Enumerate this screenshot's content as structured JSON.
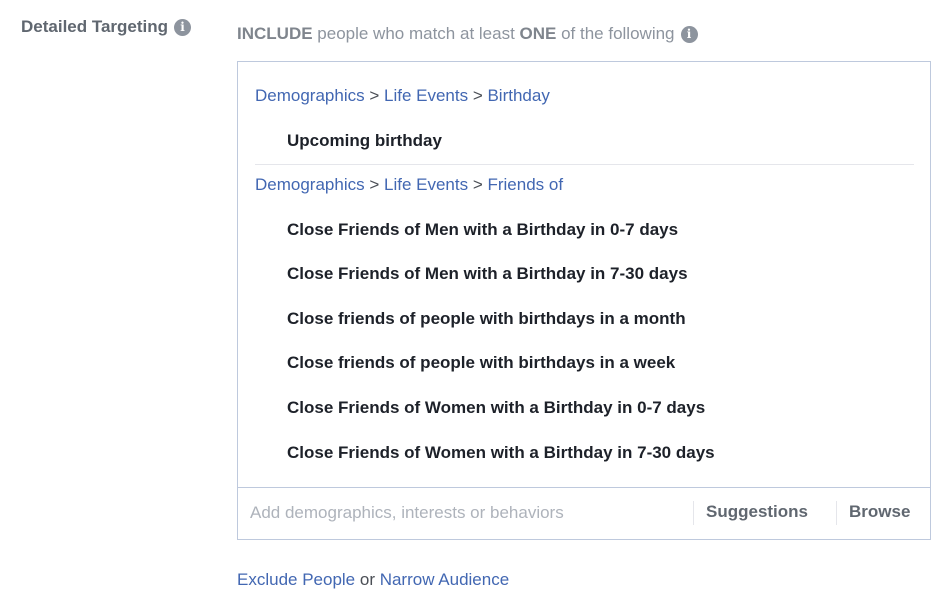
{
  "section": {
    "label": "Detailed Targeting",
    "info_icon": "info-icon"
  },
  "include": {
    "prefix": "INCLUDE",
    "middle": " people who match at least ",
    "emphasis": "ONE",
    "suffix": " of the following"
  },
  "groups": [
    {
      "path": [
        "Demographics",
        "Life Events",
        "Birthday"
      ],
      "items": [
        "Upcoming birthday"
      ]
    },
    {
      "path": [
        "Demographics",
        "Life Events",
        "Friends of"
      ],
      "items": [
        "Close Friends of Men with a Birthday in 0-7 days",
        "Close Friends of Men with a Birthday in 7-30 days",
        "Close friends of people with birthdays in a month",
        "Close friends of people with birthdays in a week",
        "Close Friends of Women with a Birthday in 0-7 days",
        "Close Friends of Women with a Birthday in 7-30 days"
      ]
    }
  ],
  "path_separator": " > ",
  "search": {
    "placeholder": "Add demographics, interests or behaviors",
    "suggestions_label": "Suggestions",
    "browse_label": "Browse"
  },
  "footer": {
    "exclude_label": "Exclude People",
    "or_text": " or ",
    "narrow_label": "Narrow Audience"
  },
  "colors": {
    "link": "#4267b2",
    "label": "#606770",
    "border": "#bec9dd"
  }
}
